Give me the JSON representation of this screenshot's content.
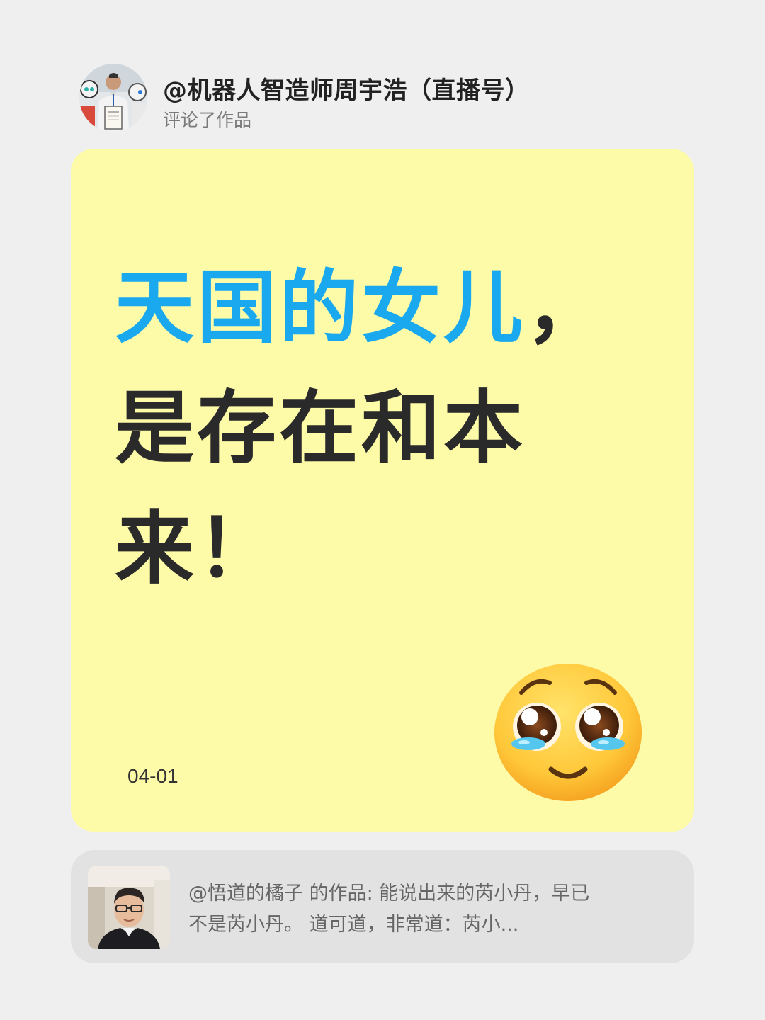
{
  "comment_header": {
    "author_name": "@机器人智造师周宇浩（直播号）",
    "action_text": "评论了作品"
  },
  "comment_card": {
    "headline_highlight": "天国的女儿",
    "headline_punct": "，",
    "headline_line2": "是存在和本",
    "headline_line3": "来！",
    "date": "04-01",
    "emoji_icon": "pleading-face-tears-icon",
    "background_color": "#fefba8",
    "highlight_color": "#1aa9ef"
  },
  "referenced_work": {
    "line1": "@悟道的橘子 的作品: 能说出来的芮小丹，早已",
    "line2": "不是芮小丹。 道可道，非常道：芮小..."
  }
}
